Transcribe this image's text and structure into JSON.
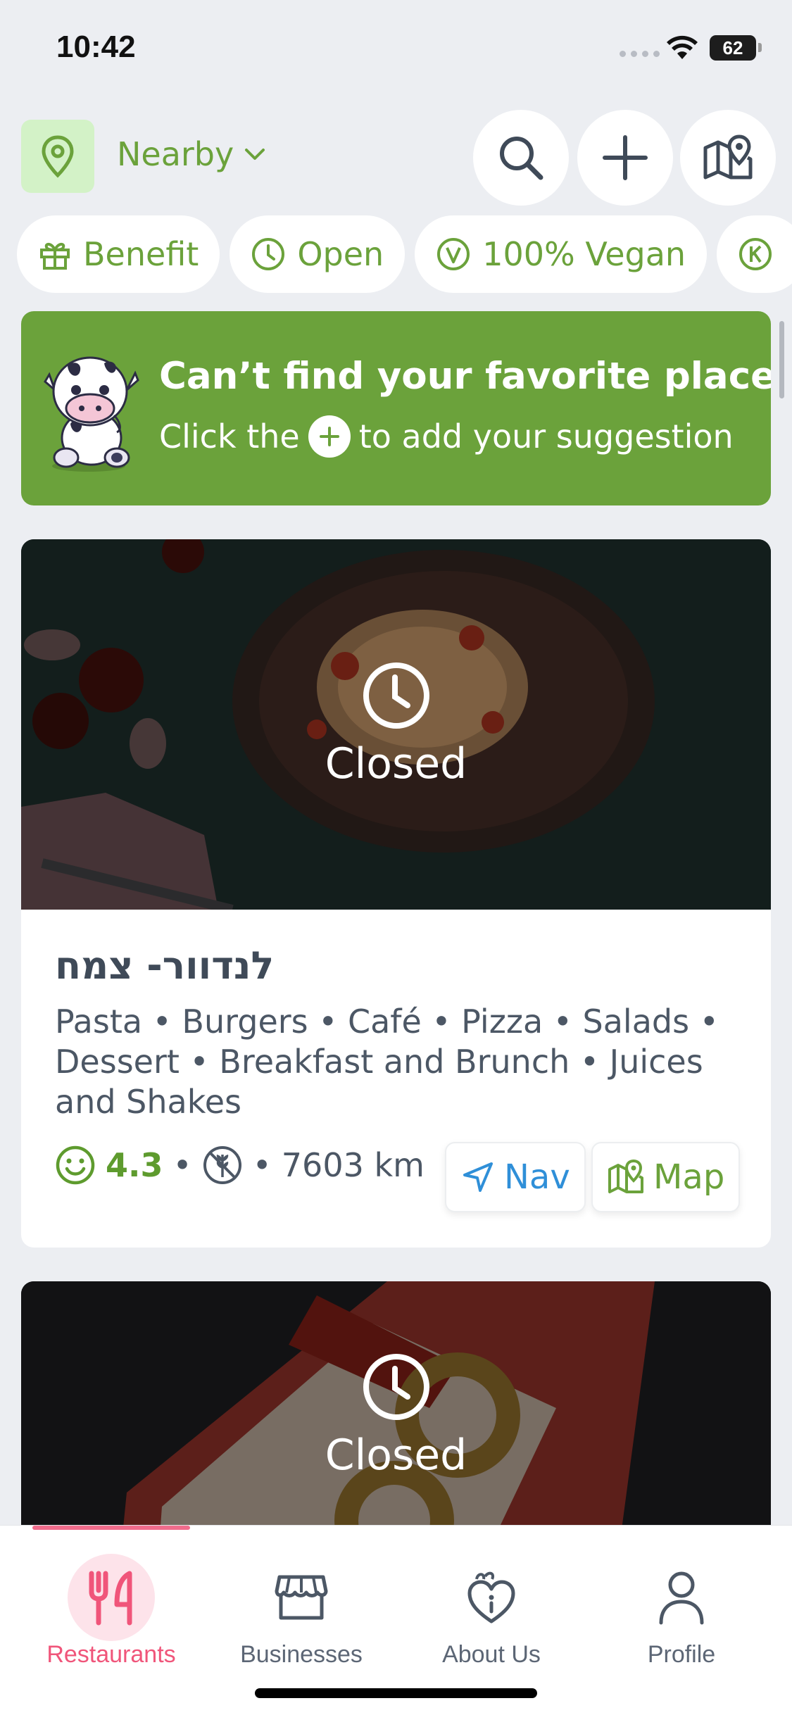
{
  "status": {
    "time": "10:42",
    "battery": "62"
  },
  "header": {
    "location_label": "Nearby",
    "search_icon": "search-icon",
    "add_icon": "plus-icon",
    "map_icon": "map-icon"
  },
  "filters": [
    {
      "label": "Benefit",
      "icon": "gift-icon"
    },
    {
      "label": "Open",
      "icon": "clock-icon"
    },
    {
      "label": "100% Vegan",
      "icon": "vegan-icon"
    },
    {
      "label": "",
      "icon": "kosher-icon"
    }
  ],
  "banner": {
    "title": "Can’t find your favorite place?",
    "subtitle_before": "Click the",
    "subtitle_after": "to add your suggestion"
  },
  "restaurants": [
    {
      "name": "לנדוור- צמח",
      "status": "Closed",
      "tags": "Pasta • Burgers • Café • Pizza • Salads • Dessert • Breakfast and Brunch • Juices and Shakes",
      "rating": "4.3",
      "distance": "7603 km",
      "nav_label": "Nav",
      "map_label": "Map"
    },
    {
      "status": "Closed"
    }
  ],
  "tabs": [
    {
      "label": "Restaurants",
      "icon": "fork-knife-icon",
      "active": true
    },
    {
      "label": "Businesses",
      "icon": "store-icon",
      "active": false
    },
    {
      "label": "About Us",
      "icon": "heart-info-icon",
      "active": false
    },
    {
      "label": "Profile",
      "icon": "person-icon",
      "active": false
    }
  ],
  "colors": {
    "brand_green": "#6ba23b",
    "active_tab": "#f06c8c",
    "nav_blue": "#2f8fd8"
  }
}
